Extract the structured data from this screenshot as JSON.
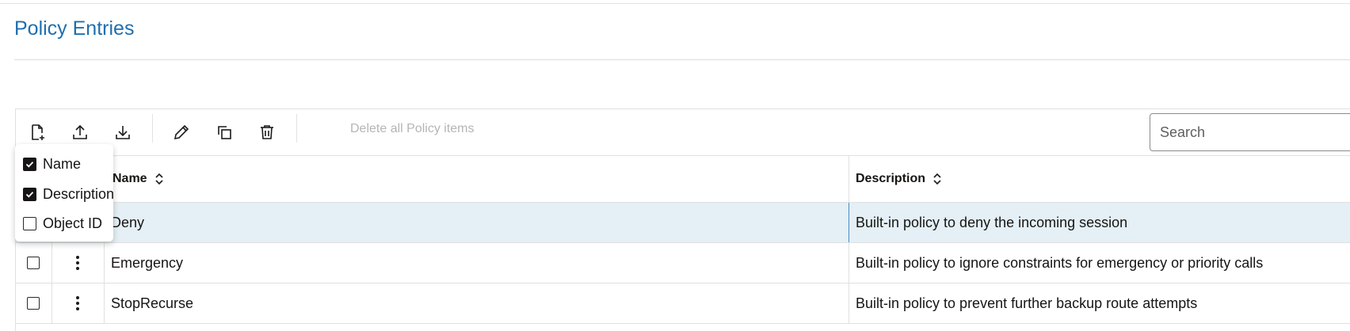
{
  "page": {
    "title": "Policy Entries"
  },
  "toolbar": {
    "buttons": [
      {
        "icon": "add-file-icon"
      },
      {
        "icon": "upload-icon"
      },
      {
        "icon": "download-icon"
      },
      {
        "icon": "edit-icon"
      },
      {
        "icon": "duplicate-icon"
      },
      {
        "icon": "delete-icon"
      }
    ],
    "delete_all_label": "Delete all Policy items",
    "search_placeholder": "Search"
  },
  "table": {
    "columns": [
      {
        "label": "Name",
        "sortable": true
      },
      {
        "label": "Description",
        "sortable": true
      }
    ],
    "rows": [
      {
        "name": "Deny",
        "description": "Built-in policy to deny the incoming session",
        "selected": true
      },
      {
        "name": "Emergency",
        "description": "Built-in policy to ignore constraints for emergency or priority calls",
        "selected": false
      },
      {
        "name": "StopRecurse",
        "description": "Built-in policy to prevent further backup route attempts",
        "selected": false
      }
    ]
  },
  "column_menu": {
    "items": [
      {
        "label": "Name",
        "checked": true
      },
      {
        "label": "Description",
        "checked": true
      },
      {
        "label": "Object ID",
        "checked": false
      }
    ]
  },
  "colors": {
    "title": "#1f6fae",
    "selected_row": "#e4eff6",
    "text": "#161513"
  }
}
